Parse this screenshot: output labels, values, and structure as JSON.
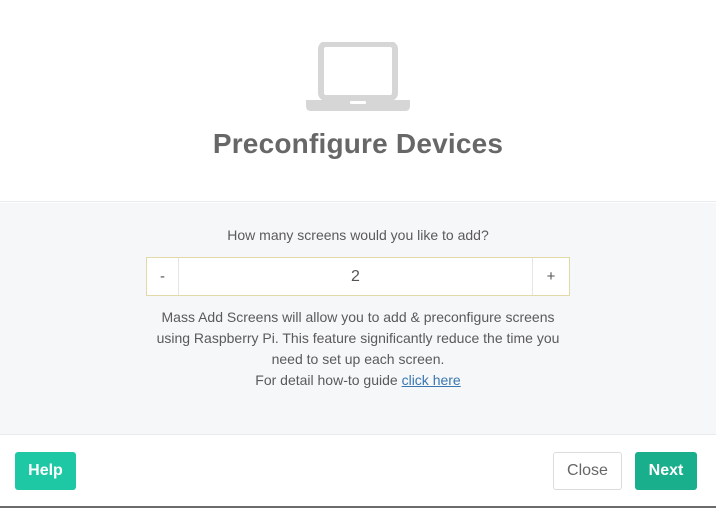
{
  "header": {
    "icon": "laptop-icon",
    "title": "Preconfigure Devices"
  },
  "body": {
    "question": "How many screens would you like to add?",
    "stepper": {
      "minus_label": "-",
      "value": "2",
      "plus_label": "+"
    },
    "description_line1": "Mass Add Screens will allow you to add & preconfigure screens",
    "description_line2": "using Raspberry Pi. This feature significantly reduce the time you",
    "description_line3": "need to set up each screen.",
    "guide_prefix": "For detail how-to guide ",
    "guide_link": "click here"
  },
  "footer": {
    "help_label": "Help",
    "close_label": "Close",
    "next_label": "Next"
  },
  "colors": {
    "accent": "#1fc8a5",
    "accent_dark": "#1aaf8c",
    "link": "#3a77b0",
    "title": "#676767"
  }
}
